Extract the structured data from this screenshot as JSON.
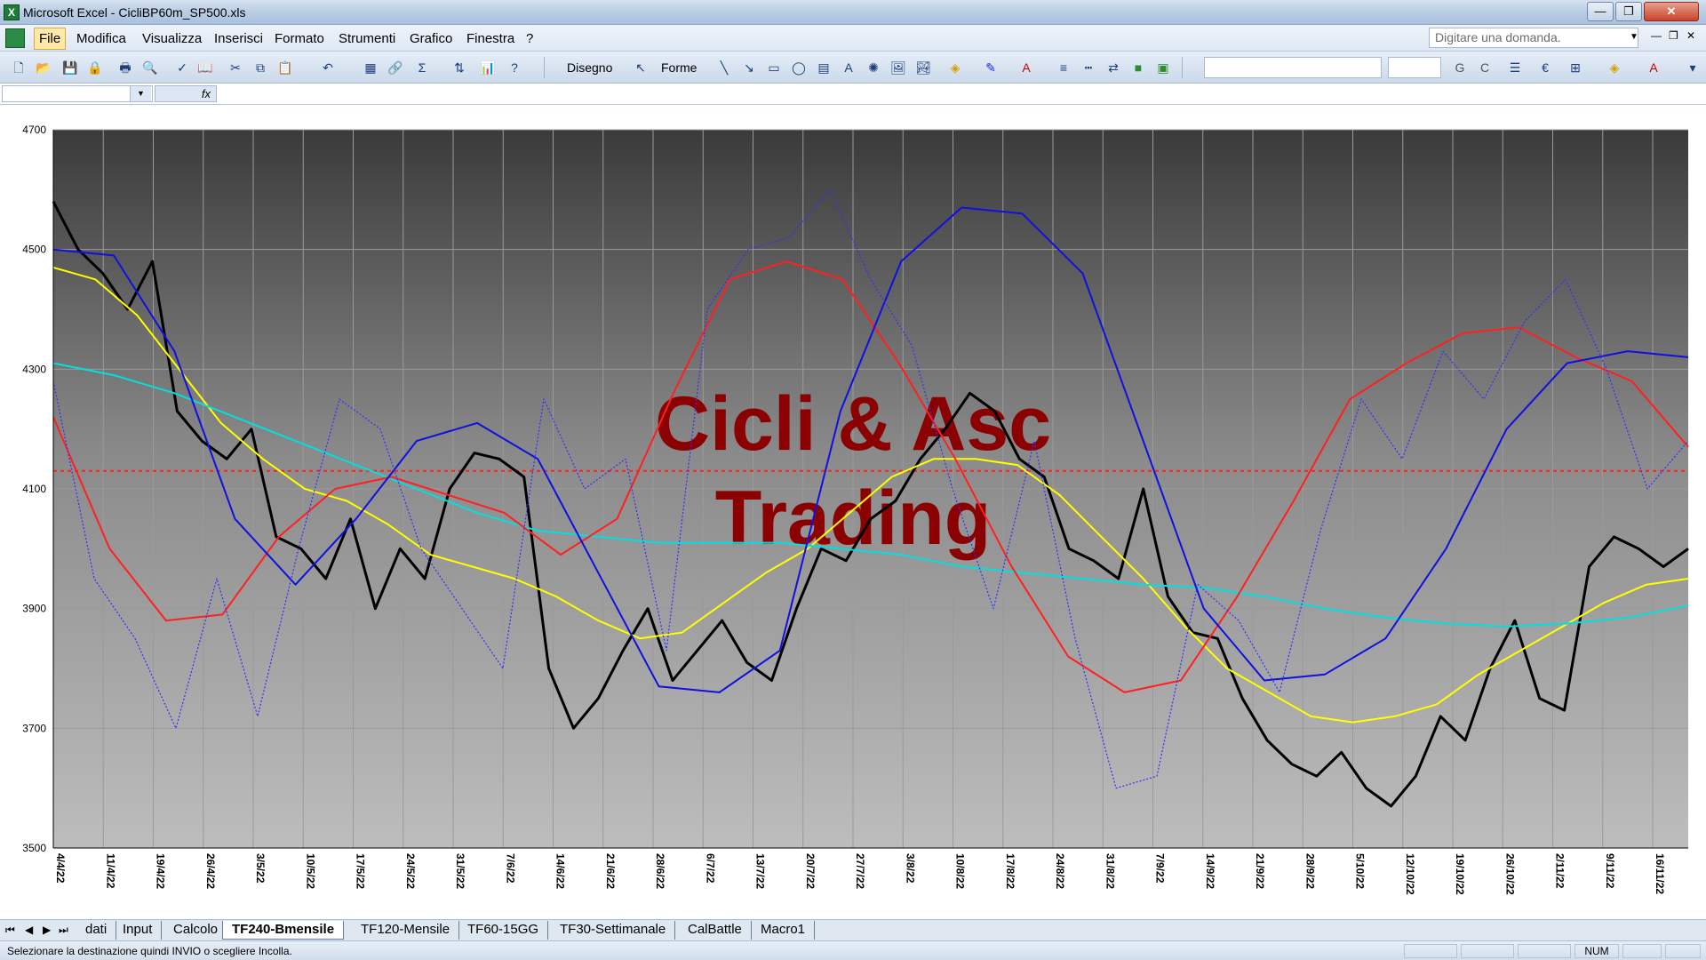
{
  "window": {
    "title": "Microsoft Excel - CicliBP60m_SP500.xls",
    "minimize": "—",
    "restore": "❐",
    "close": "✕"
  },
  "menu": {
    "items": [
      "File",
      "Modifica",
      "Visualizza",
      "Inserisci",
      "Formato",
      "Strumenti",
      "Grafico",
      "Finestra",
      "?"
    ],
    "active": "File",
    "help_box_placeholder": "Digitare una domanda.",
    "doc_min": "—",
    "doc_restore": "❐",
    "doc_close": "✕"
  },
  "toolbar": {
    "draw_label": "Disegno",
    "shapes_label": "Forme",
    "bold_label": "G",
    "italic_label": "C",
    "euro_label": "€"
  },
  "formula_bar": {
    "name_box": "",
    "fx_label": "fx",
    "value": ""
  },
  "chart_data": {
    "type": "line",
    "watermark_line1": "Cicli & Asc",
    "watermark_line2": "Trading",
    "ylim": [
      3500,
      4700
    ],
    "yticks": [
      3500,
      3700,
      3900,
      4100,
      4300,
      4500,
      4700
    ],
    "reference_line": 4130,
    "x_labels": [
      "4/4/22",
      "11/4/22",
      "19/4/22",
      "26/4/22",
      "3/5/22",
      "10/5/22",
      "17/5/22",
      "24/5/22",
      "31/5/22",
      "7/6/22",
      "14/6/22",
      "21/6/22",
      "28/6/22",
      "6/7/22",
      "13/7/22",
      "20/7/22",
      "27/7/22",
      "3/8/22",
      "10/8/22",
      "17/8/22",
      "24/8/22",
      "31/8/22",
      "7/9/22",
      "14/9/22",
      "21/9/22",
      "28/9/22",
      "5/10/22",
      "12/10/22",
      "19/10/22",
      "26/10/22",
      "2/11/22",
      "9/11/22",
      "16/11/22"
    ],
    "series": [
      {
        "color": "#000000",
        "style": "price",
        "values": [
          4580,
          4500,
          4460,
          4400,
          4480,
          4230,
          4180,
          4150,
          4200,
          4020,
          4000,
          3950,
          4050,
          3900,
          4000,
          3950,
          4100,
          4160,
          4150,
          4120,
          3800,
          3700,
          3750,
          3830,
          3900,
          3780,
          3830,
          3880,
          3810,
          3780,
          3900,
          4000,
          3980,
          4050,
          4080,
          4150,
          4200,
          4260,
          4230,
          4150,
          4120,
          4000,
          3980,
          3950,
          4100,
          3920,
          3860,
          3850,
          3750,
          3680,
          3640,
          3620,
          3660,
          3600,
          3570,
          3620,
          3720,
          3680,
          3800,
          3880,
          3750,
          3730,
          3970,
          4020,
          4000,
          3970,
          4000
        ]
      },
      {
        "color": "#ffff00",
        "style": "line",
        "values": [
          4470,
          4450,
          4390,
          4300,
          4210,
          4150,
          4100,
          4080,
          4040,
          3990,
          3970,
          3950,
          3920,
          3880,
          3850,
          3860,
          3910,
          3960,
          4000,
          4060,
          4120,
          4150,
          4150,
          4140,
          4090,
          4020,
          3950,
          3870,
          3800,
          3760,
          3720,
          3710,
          3720,
          3740,
          3790,
          3830,
          3870,
          3910,
          3940,
          3950
        ]
      },
      {
        "color": "#00e0e0",
        "style": "line",
        "values": [
          4310,
          4290,
          4260,
          4220,
          4180,
          4140,
          4100,
          4060,
          4030,
          4020,
          4010,
          4010,
          4010,
          4000,
          3990,
          3970,
          3960,
          3950,
          3940,
          3935,
          3920,
          3900,
          3885,
          3875,
          3870,
          3875,
          3885,
          3905
        ]
      },
      {
        "color": "#ff2020",
        "style": "line",
        "values": [
          4220,
          4000,
          3880,
          3890,
          4020,
          4100,
          4120,
          4090,
          4060,
          3990,
          4050,
          4260,
          4450,
          4480,
          4450,
          4310,
          4150,
          3970,
          3820,
          3760,
          3780,
          3920,
          4080,
          4250,
          4310,
          4360,
          4370,
          4320,
          4280,
          4170
        ]
      },
      {
        "color": "#1010e0",
        "style": "line",
        "values": [
          4500,
          4490,
          4330,
          4050,
          3940,
          4050,
          4180,
          4210,
          4150,
          3960,
          3770,
          3760,
          3830,
          4230,
          4480,
          4570,
          4560,
          4460,
          4180,
          3900,
          3780,
          3790,
          3850,
          4000,
          4200,
          4310,
          4330,
          4320
        ]
      },
      {
        "color": "#3030ff",
        "style": "dotted",
        "values": [
          4280,
          3950,
          3850,
          3700,
          3950,
          3720,
          4000,
          4250,
          4200,
          4000,
          3900,
          3800,
          4250,
          4100,
          4150,
          3830,
          4400,
          4500,
          4520,
          4600,
          4450,
          4340,
          4100,
          3900,
          4180,
          3850,
          3600,
          3620,
          3940,
          3880,
          3760,
          4030,
          4250,
          4150,
          4330,
          4250,
          4380,
          4450,
          4300,
          4100,
          4180
        ]
      }
    ]
  },
  "sheet_tabs": {
    "nav_first": "⏮",
    "nav_prev": "◀",
    "nav_next": "▶",
    "nav_last": "⏭",
    "tabs": [
      "dati",
      "Input",
      "Calcolo",
      "TF240-Bmensile",
      "TF120-Mensile",
      "TF60-15GG",
      "TF30-Settimanale",
      "CalBattle",
      "Macro1"
    ],
    "active": "TF240-Bmensile"
  },
  "status": {
    "message": "Selezionare la destinazione quindi INVIO o scegliere Incolla.",
    "num": "NUM"
  }
}
